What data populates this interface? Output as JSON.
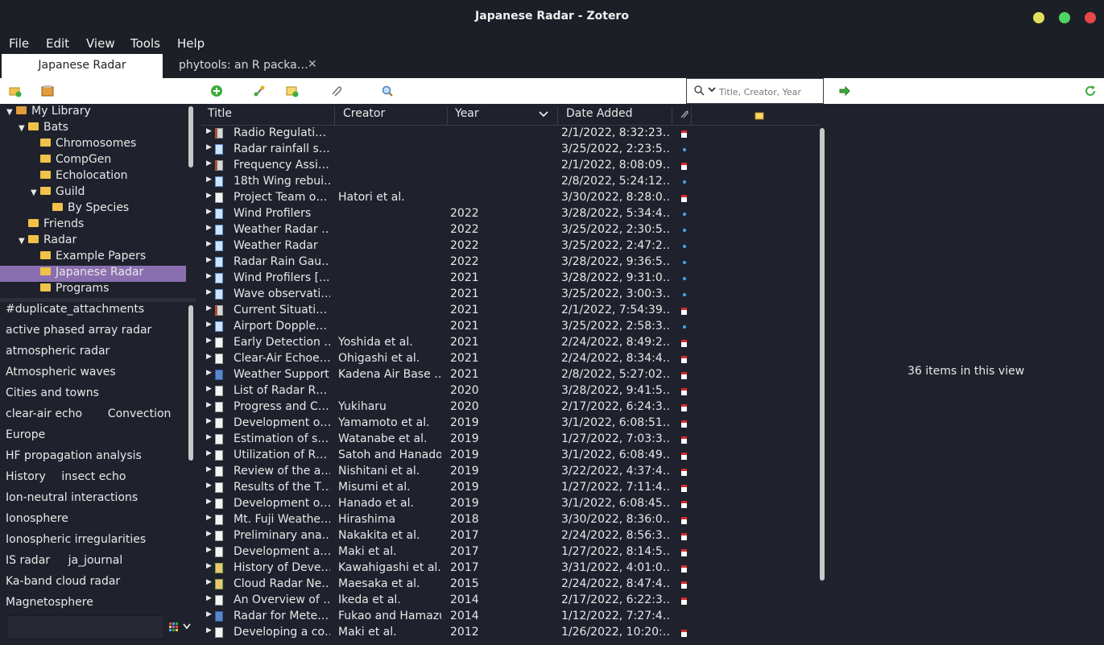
{
  "window": {
    "title": "Japanese Radar - Zotero",
    "btn_colors": [
      "#e2e05a",
      "#4cd564",
      "#e8474a"
    ]
  },
  "menu": {
    "file": "File",
    "edit": "Edit",
    "view": "View",
    "tools": "Tools",
    "help": "Help"
  },
  "tabs": [
    "Japanese Radar",
    "phytools: an R packa…"
  ],
  "toolbar": {
    "icons": [
      "new-collection-icon",
      "new-library-icon",
      "new-item-icon",
      "add-by-identifier-icon",
      "new-note-icon",
      "attachment-icon",
      "advanced-search-icon",
      "locate-icon",
      "sync-icon"
    ]
  },
  "search": {
    "placeholder": "Title, Creator, Year"
  },
  "collections": [
    {
      "label": "My Library",
      "level": 0,
      "twisty": "open",
      "lib": true
    },
    {
      "label": "Bats",
      "level": 1,
      "twisty": "open"
    },
    {
      "label": "Chromosomes",
      "level": 2
    },
    {
      "label": "CompGen",
      "level": 2
    },
    {
      "label": "Echolocation",
      "level": 2
    },
    {
      "label": "Guild",
      "level": 2,
      "twisty": "open"
    },
    {
      "label": "By Species",
      "level": 3
    },
    {
      "label": "Friends",
      "level": 1
    },
    {
      "label": "Radar",
      "level": 1,
      "twisty": "open"
    },
    {
      "label": "Example Papers",
      "level": 2
    },
    {
      "label": "Japanese Radar",
      "level": 2,
      "selected": true
    },
    {
      "label": "Programs",
      "level": 2
    }
  ],
  "tags": [
    [
      "#duplicate_attachments"
    ],
    [
      "active phased array radar"
    ],
    [
      "atmospheric radar"
    ],
    [
      "Atmospheric waves"
    ],
    [
      "Cities and towns"
    ],
    [
      "clear-air echo",
      "Convection"
    ],
    [
      "Europe"
    ],
    [
      "HF propagation analysis"
    ],
    [
      "History",
      "insect echo"
    ],
    [
      "Ion-neutral interactions"
    ],
    [
      "Ionosphere"
    ],
    [
      "Ionospheric irregularities"
    ],
    [
      "IS radar",
      "ja_journal"
    ],
    [
      "Ka-band cloud radar"
    ],
    [
      "Magnetosphere"
    ]
  ],
  "columns": {
    "title": "Title",
    "creator": "Creator",
    "year": "Year",
    "date_added": "Date Added"
  },
  "items": [
    {
      "title": "Radio Regulati…",
      "creator": "",
      "year": "",
      "date": "2/1/2022, 8:32:23…",
      "type": "book",
      "att": "pdf"
    },
    {
      "title": "Radar rainfall s…",
      "creator": "",
      "year": "",
      "date": "3/25/2022, 2:23:5…",
      "type": "web",
      "att": "dot"
    },
    {
      "title": "Frequency Assi…",
      "creator": "",
      "year": "",
      "date": "2/1/2022, 8:08:09…",
      "type": "book",
      "att": "pdf"
    },
    {
      "title": "18th Wing rebui…",
      "creator": "",
      "year": "",
      "date": "2/8/2022, 5:24:12…",
      "type": "web",
      "att": "dot"
    },
    {
      "title": "Project Team o…",
      "creator": "Hatori et al.",
      "year": "",
      "date": "3/30/2022, 8:28:0…",
      "type": "doc",
      "att": "pdf"
    },
    {
      "title": "Wind Profilers",
      "creator": "",
      "year": "2022",
      "date": "3/28/2022, 5:34:4…",
      "type": "web",
      "att": "dot"
    },
    {
      "title": "Weather Radar …",
      "creator": "",
      "year": "2022",
      "date": "3/25/2022, 2:30:5…",
      "type": "web",
      "att": "dot"
    },
    {
      "title": "Weather Radar",
      "creator": "",
      "year": "2022",
      "date": "3/25/2022, 2:47:2…",
      "type": "web",
      "att": "dot"
    },
    {
      "title": "Radar Rain Gau…",
      "creator": "",
      "year": "2022",
      "date": "3/28/2022, 9:36:5…",
      "type": "web",
      "att": "dot"
    },
    {
      "title": "Wind Profilers [...",
      "creator": "",
      "year": "2021",
      "date": "3/28/2022, 9:31:0…",
      "type": "web",
      "att": "dot"
    },
    {
      "title": "Wave observati…",
      "creator": "",
      "year": "2021",
      "date": "3/25/2022, 3:00:3…",
      "type": "web",
      "att": "dot"
    },
    {
      "title": "Current Situati…",
      "creator": "",
      "year": "2021",
      "date": "2/1/2022, 7:54:39…",
      "type": "book",
      "att": "pdf"
    },
    {
      "title": "Airport Dopple…",
      "creator": "",
      "year": "2021",
      "date": "3/25/2022, 2:58:3…",
      "type": "web",
      "att": "dot"
    },
    {
      "title": "Early Detection …",
      "creator": "Yoshida et al.",
      "year": "2021",
      "date": "2/24/2022, 8:49:2…",
      "type": "doc",
      "att": "pdf"
    },
    {
      "title": "Clear-Air Echoe…",
      "creator": "Ohigashi et al.",
      "year": "2021",
      "date": "2/24/2022, 8:34:4…",
      "type": "doc",
      "att": "pdf"
    },
    {
      "title": "Weather Support",
      "creator": "Kadena Air Base …",
      "year": "2021",
      "date": "2/8/2022, 5:27:02…",
      "type": "thesis",
      "att": "pdf"
    },
    {
      "title": "List of Radar R…",
      "creator": "",
      "year": "2020",
      "date": "3/28/2022, 9:41:5…",
      "type": "doc",
      "att": "pdf"
    },
    {
      "title": "Progress and C…",
      "creator": "Yukiharu",
      "year": "2020",
      "date": "2/17/2022, 6:24:3…",
      "type": "doc",
      "att": "pdf"
    },
    {
      "title": "Development o…",
      "creator": "Yamamoto et al.",
      "year": "2019",
      "date": "3/1/2022, 6:08:51…",
      "type": "doc",
      "att": "pdf"
    },
    {
      "title": "Estimation of s…",
      "creator": "Watanabe et al.",
      "year": "2019",
      "date": "1/27/2022, 7:03:3…",
      "type": "doc",
      "att": "pdf"
    },
    {
      "title": "Utilization of R…",
      "creator": "Satoh and Hanado",
      "year": "2019",
      "date": "3/1/2022, 6:08:49…",
      "type": "doc",
      "att": "pdf"
    },
    {
      "title": "Review of the a…",
      "creator": "Nishitani et al.",
      "year": "2019",
      "date": "3/22/2022, 4:37:4…",
      "type": "doc",
      "att": "pdf"
    },
    {
      "title": "Results of the T…",
      "creator": "Misumi et al.",
      "year": "2019",
      "date": "1/27/2022, 7:11:4…",
      "type": "doc",
      "att": "pdf"
    },
    {
      "title": "Development o…",
      "creator": "Hanado et al.",
      "year": "2019",
      "date": "3/1/2022, 6:08:45…",
      "type": "doc",
      "att": "pdf"
    },
    {
      "title": "Mt. Fuji Weathe…",
      "creator": "Hirashima",
      "year": "2018",
      "date": "3/30/2022, 8:36:0…",
      "type": "doc",
      "att": "pdf"
    },
    {
      "title": "Preliminary ana…",
      "creator": "Nakakita et al.",
      "year": "2017",
      "date": "2/24/2022, 8:56:3…",
      "type": "doc",
      "att": "pdf"
    },
    {
      "title": "Development a…",
      "creator": "Maki et al.",
      "year": "2017",
      "date": "1/27/2022, 8:14:5…",
      "type": "doc",
      "att": "pdf"
    },
    {
      "title": "History of Deve…",
      "creator": "Kawahigashi et al.",
      "year": "2017",
      "date": "3/31/2022, 4:01:0…",
      "type": "img",
      "att": "pdf"
    },
    {
      "title": "Cloud Radar Ne…",
      "creator": "Maesaka et al.",
      "year": "2015",
      "date": "2/24/2022, 8:47:4…",
      "type": "img",
      "att": "pdf"
    },
    {
      "title": "An Overview of …",
      "creator": "Ikeda et al.",
      "year": "2014",
      "date": "2/17/2022, 6:22:3…",
      "type": "doc",
      "att": "pdf"
    },
    {
      "title": "Radar for Mete…",
      "creator": "Fukao and Hamazu",
      "year": "2014",
      "date": "1/12/2022, 7:27:4…",
      "type": "thesis",
      "att": ""
    },
    {
      "title": "Developing a co…",
      "creator": "Maki et al.",
      "year": "2012",
      "date": "1/26/2022, 10:20:…",
      "type": "doc",
      "att": "pdf"
    }
  ],
  "right_pane": {
    "count_text": "36 items in this view"
  }
}
